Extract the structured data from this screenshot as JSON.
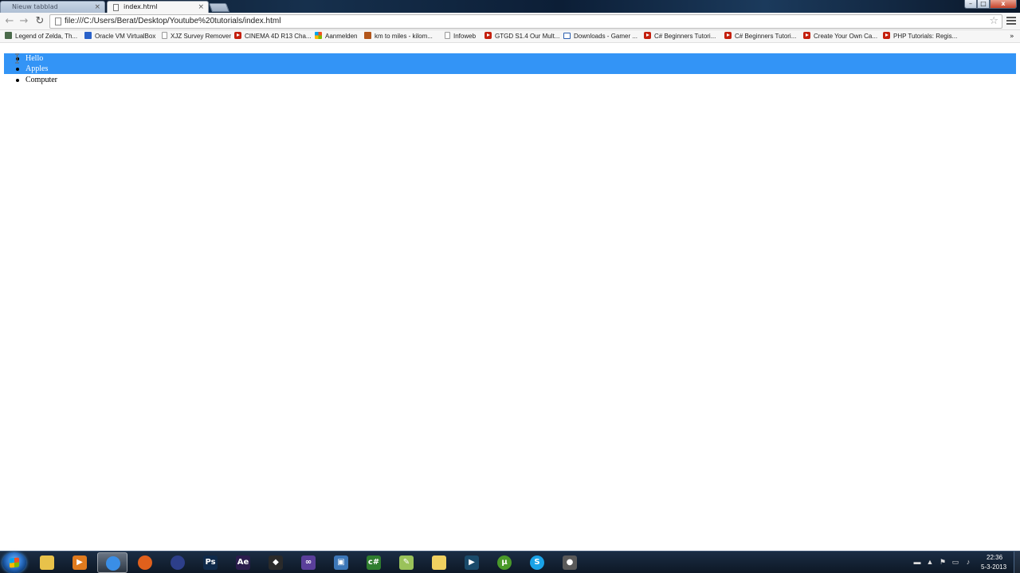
{
  "browser": {
    "tabs": [
      {
        "label": "Nieuw tabblad",
        "active": false
      },
      {
        "label": "index.html",
        "active": true
      }
    ],
    "tab_close_glyph": "×",
    "url": "file:///C:/Users/Berat/Desktop/Youtube%20tutorials/index.html",
    "nav": {
      "back_glyph": "←",
      "forward_glyph": "→",
      "reload_glyph": "↻",
      "star_glyph": "☆"
    },
    "window_controls": {
      "minimize": "–",
      "maximize": "□",
      "close": "x"
    }
  },
  "bookmarks": [
    {
      "label": "Legend of Zelda, Th...",
      "icon": "zelda"
    },
    {
      "label": "Oracle VM VirtualBox",
      "icon": "vbox"
    },
    {
      "label": "XJZ Survey Remover",
      "icon": "page"
    },
    {
      "label": "CINEMA 4D R13 Cha...",
      "icon": "yt"
    },
    {
      "label": "Aanmelden",
      "icon": "winlogo"
    },
    {
      "label": "km to miles - kilom...",
      "icon": "km"
    },
    {
      "label": "Infoweb",
      "icon": "page"
    },
    {
      "label": "GTGD S1.4 Our Mult...",
      "icon": "yt"
    },
    {
      "label": "Downloads - Gamer ...",
      "icon": "folder"
    },
    {
      "label": "C# Beginners Tutori...",
      "icon": "yt"
    },
    {
      "label": "C# Beginners Tutori...",
      "icon": "yt"
    },
    {
      "label": "Create Your Own Ca...",
      "icon": "yt"
    },
    {
      "label": "PHP Tutorials: Regis...",
      "icon": "yt"
    }
  ],
  "bookmarks_overflow_glyph": "»",
  "page": {
    "list_items": [
      {
        "label": "Hello",
        "selected": true
      },
      {
        "label": "Apples",
        "selected": true
      },
      {
        "label": "Computer",
        "selected": false
      }
    ],
    "selection_color": "#3394f6"
  },
  "taskbar": {
    "apps": [
      {
        "name": "windows-explorer",
        "glyph": "",
        "color": "#e8c24a"
      },
      {
        "name": "media-player",
        "glyph": "▶",
        "color": "#e07b1f"
      },
      {
        "name": "chrome",
        "glyph": "",
        "color": "#3a8ee6",
        "active": true
      },
      {
        "name": "firefox",
        "glyph": "",
        "color": "#e0601c"
      },
      {
        "name": "eclipse",
        "glyph": "",
        "color": "#2d3f8a"
      },
      {
        "name": "photoshop",
        "glyph": "Ps",
        "color": "#0f2a4a"
      },
      {
        "name": "after-effects",
        "glyph": "Ae",
        "color": "#2b1d4d"
      },
      {
        "name": "unity",
        "glyph": "◆",
        "color": "#2a2a2a"
      },
      {
        "name": "visual-studio",
        "glyph": "∞",
        "color": "#5a3f9a"
      },
      {
        "name": "remote-desktop",
        "glyph": "▣",
        "color": "#3c77b8"
      },
      {
        "name": "csharp-express",
        "glyph": "c#",
        "color": "#2f7d2f"
      },
      {
        "name": "notepad-plus-plus",
        "glyph": "✎",
        "color": "#9ac25a"
      },
      {
        "name": "sticky-folder",
        "glyph": "",
        "color": "#f0d060"
      },
      {
        "name": "movie-player",
        "glyph": "▶",
        "color": "#1a4a6a"
      },
      {
        "name": "utorrent",
        "glyph": "µ",
        "color": "#4a9a2a"
      },
      {
        "name": "skype",
        "glyph": "S",
        "color": "#1aa3e8"
      },
      {
        "name": "screen-recorder",
        "glyph": "●",
        "color": "#5a5a5a"
      }
    ],
    "tray_icons": [
      "▬",
      "▲",
      "⚑",
      "▭",
      "♪"
    ],
    "clock_time": "22:36",
    "clock_date": "5-3-2013"
  }
}
